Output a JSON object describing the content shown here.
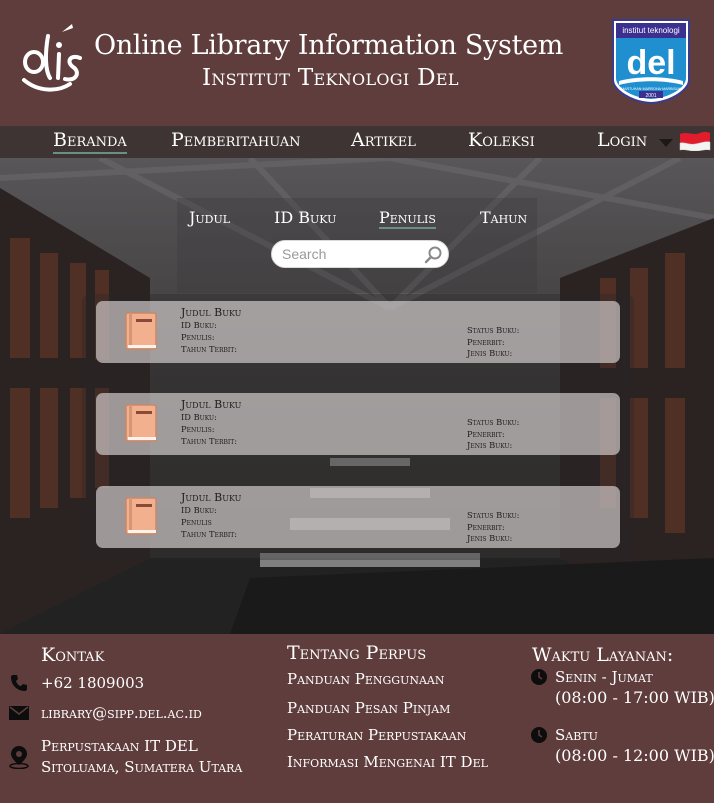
{
  "header": {
    "logo_text": "olis",
    "title": "Online Library Information System",
    "subtitle": "Institut Teknologi Del",
    "del_logo": {
      "top_text": "institut teknologi",
      "word": "del",
      "motto": "MARTUHAN·MARROHA·MARBISUK",
      "year": "2001"
    }
  },
  "nav": {
    "items": [
      {
        "label": "Beranda",
        "active": true
      },
      {
        "label": "Pemberitahuan",
        "active": false
      },
      {
        "label": "Artikel",
        "active": false
      },
      {
        "label": "Koleksi",
        "active": false
      },
      {
        "label": "Login",
        "active": false
      }
    ],
    "language_flag": "indonesia-flag-icon"
  },
  "filters": {
    "tabs": [
      {
        "label": "Judul",
        "active": false
      },
      {
        "label": "ID Buku",
        "active": false
      },
      {
        "label": "Penulis",
        "active": true
      },
      {
        "label": "Tahun",
        "active": false
      }
    ]
  },
  "search": {
    "placeholder": "Search",
    "value": ""
  },
  "results": [
    {
      "title": "Judul Buku",
      "id_label": "ID Buku:",
      "author_label": "Penulis:",
      "year_label": "Tahun Terbit:",
      "status_label": "Status Buku:",
      "publisher_label": "Penerbit:",
      "type_label": "Jenis Buku:"
    },
    {
      "title": "Judul Buku",
      "id_label": "ID Buku:",
      "author_label": "Penulis:",
      "year_label": "Tahun Terbit:",
      "status_label": "Status Buku:",
      "publisher_label": "Penerbit:",
      "type_label": "Jenis Buku:"
    },
    {
      "title": "Judul Buku",
      "id_label": "ID Buku:",
      "author_label": "Penulis",
      "year_label": "Tahun Terbit:",
      "status_label": "Status Buku:",
      "publisher_label": "Penerbit:",
      "type_label": "Jenis Buku:"
    }
  ],
  "footer": {
    "contact": {
      "heading": "Kontak",
      "phone": "+62 1809003",
      "email": "library@sipp.del.ac.id",
      "address_line1": "Perpustakaan IT DEL",
      "address_line2": "Sitoluama, Sumatera Utara"
    },
    "about": {
      "heading": "Tentang Perpus",
      "links": [
        "Panduan Penggunaan",
        "Panduan Pesan Pinjam",
        "Peraturan Perpustakaan",
        "Informasi Mengenai IT Del"
      ]
    },
    "hours": {
      "heading": "Waktu Layanan:",
      "weekday_label": "Senin - Jumat",
      "weekday_hours": "(08:00 - 17:00 WIB)",
      "saturday_label": "Sabtu",
      "saturday_hours": "(08:00 - 12:00 WIB)"
    }
  },
  "colors": {
    "header_bg": "#5f3d3c",
    "nav_bg": "#3f3434",
    "accent_underline": "#6a8f85",
    "book_color": "#f2b08e"
  }
}
